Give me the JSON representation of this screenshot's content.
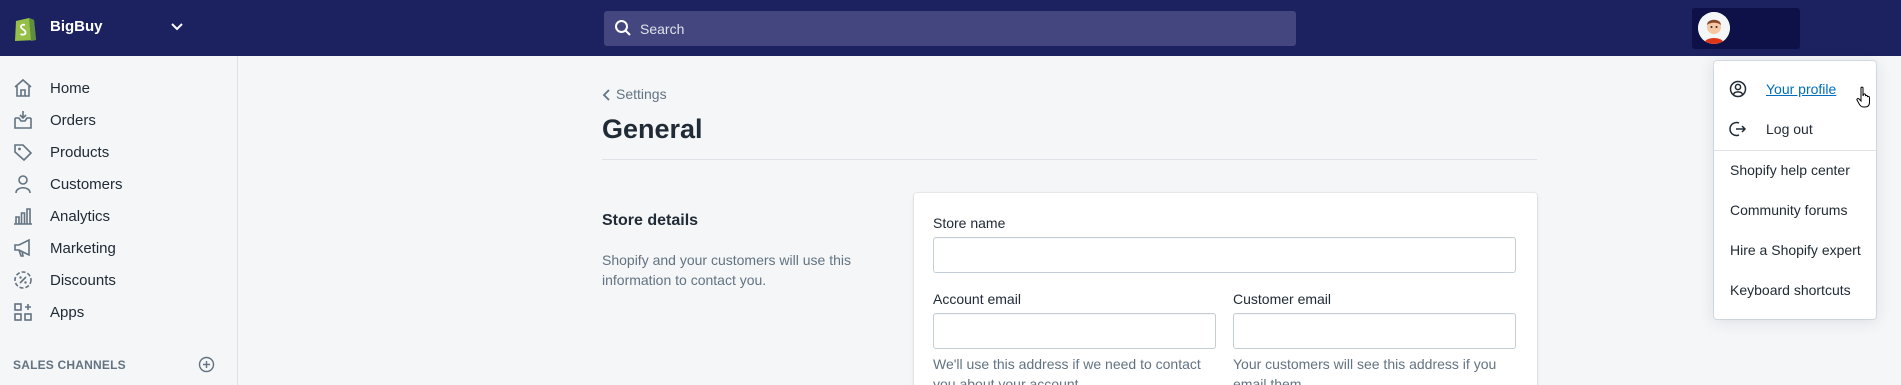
{
  "topbar": {
    "store_name": "BigBuy",
    "search_placeholder": "Search"
  },
  "sidebar": {
    "items": [
      {
        "label": "Home",
        "icon": "home-icon"
      },
      {
        "label": "Orders",
        "icon": "orders-icon"
      },
      {
        "label": "Products",
        "icon": "tag-icon"
      },
      {
        "label": "Customers",
        "icon": "person-icon"
      },
      {
        "label": "Analytics",
        "icon": "bar-chart-icon"
      },
      {
        "label": "Marketing",
        "icon": "megaphone-icon"
      },
      {
        "label": "Discounts",
        "icon": "discount-icon"
      },
      {
        "label": "Apps",
        "icon": "apps-icon"
      }
    ],
    "section_label": "SALES CHANNELS"
  },
  "main": {
    "breadcrumb": "Settings",
    "title": "General",
    "store_details": {
      "title": "Store details",
      "description": "Shopify and your customers will use this information to contact you.",
      "store_name_label": "Store name",
      "store_name_value": "",
      "account_email_label": "Account email",
      "account_email_value": "",
      "account_email_help": "We'll use this address if we need to contact you about your account.",
      "customer_email_label": "Customer email",
      "customer_email_value": "",
      "customer_email_help": "Your customers will see this address if you email them."
    }
  },
  "account_menu": {
    "items": [
      {
        "label": "Your profile",
        "icon": "profile-icon"
      },
      {
        "label": "Log out",
        "icon": "logout-icon"
      }
    ],
    "links": [
      "Shopify help center",
      "Community forums",
      "Hire a Shopify expert",
      "Keyboard shortcuts"
    ]
  },
  "colors": {
    "topbar_bg": "#1c2260",
    "search_bg": "#43467f",
    "link": "#006fbb"
  }
}
